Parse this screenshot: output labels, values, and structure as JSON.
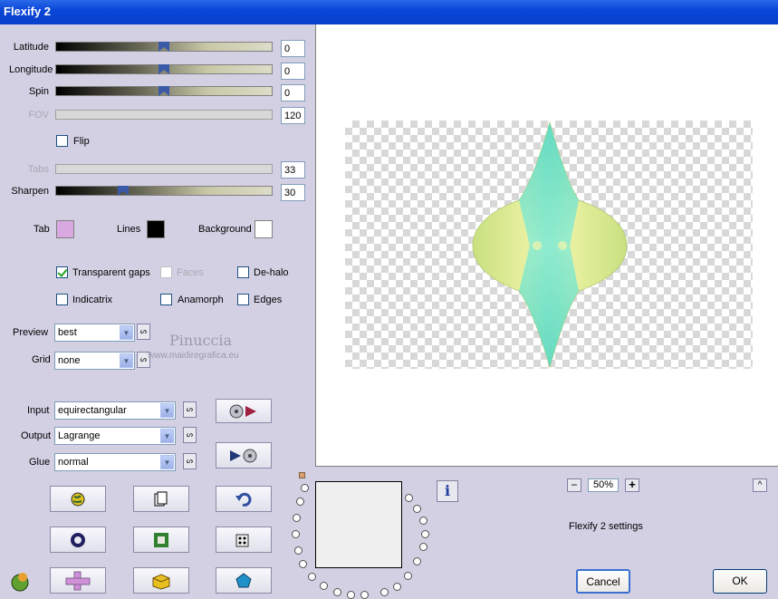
{
  "window": {
    "title": "Flexify 2"
  },
  "sliders": {
    "latitude": {
      "label": "Latitude",
      "value": "0"
    },
    "longitude": {
      "label": "Longitude",
      "value": "0"
    },
    "spin": {
      "label": "Spin",
      "value": "0"
    },
    "fov": {
      "label": "FOV",
      "value": "120"
    },
    "tabs": {
      "label": "Tabs",
      "value": "33"
    },
    "sharpen": {
      "label": "Sharpen",
      "value": "30"
    }
  },
  "flip": {
    "label": "Flip"
  },
  "colors": {
    "tab_label": "Tab",
    "tab_color": "#d8a8e0",
    "lines_label": "Lines",
    "lines_color": "#000000",
    "background_label": "Background",
    "background_color": "#ffffff"
  },
  "options": {
    "transparent_gaps": "Transparent gaps",
    "faces": "Faces",
    "de_halo": "De-halo",
    "indicatrix": "Indicatrix",
    "anamorph": "Anamorph",
    "edges": "Edges"
  },
  "selects": {
    "preview": {
      "label": "Preview",
      "value": "best"
    },
    "grid": {
      "label": "Grid",
      "value": "none"
    },
    "input": {
      "label": "Input",
      "value": "equirectangular"
    },
    "output": {
      "label": "Output",
      "value": "Lagrange"
    },
    "glue": {
      "label": "Glue",
      "value": "normal"
    }
  },
  "watermark": {
    "name": "Pinuccia",
    "url": "www.maidiregrafica.eu"
  },
  "zoom": {
    "minus": "−",
    "value": "50%",
    "plus": "+"
  },
  "caret": "^",
  "status": "Flexify 2 settings",
  "buttons": {
    "cancel": "Cancel",
    "ok": "OK"
  },
  "accent": "#0a46d8"
}
